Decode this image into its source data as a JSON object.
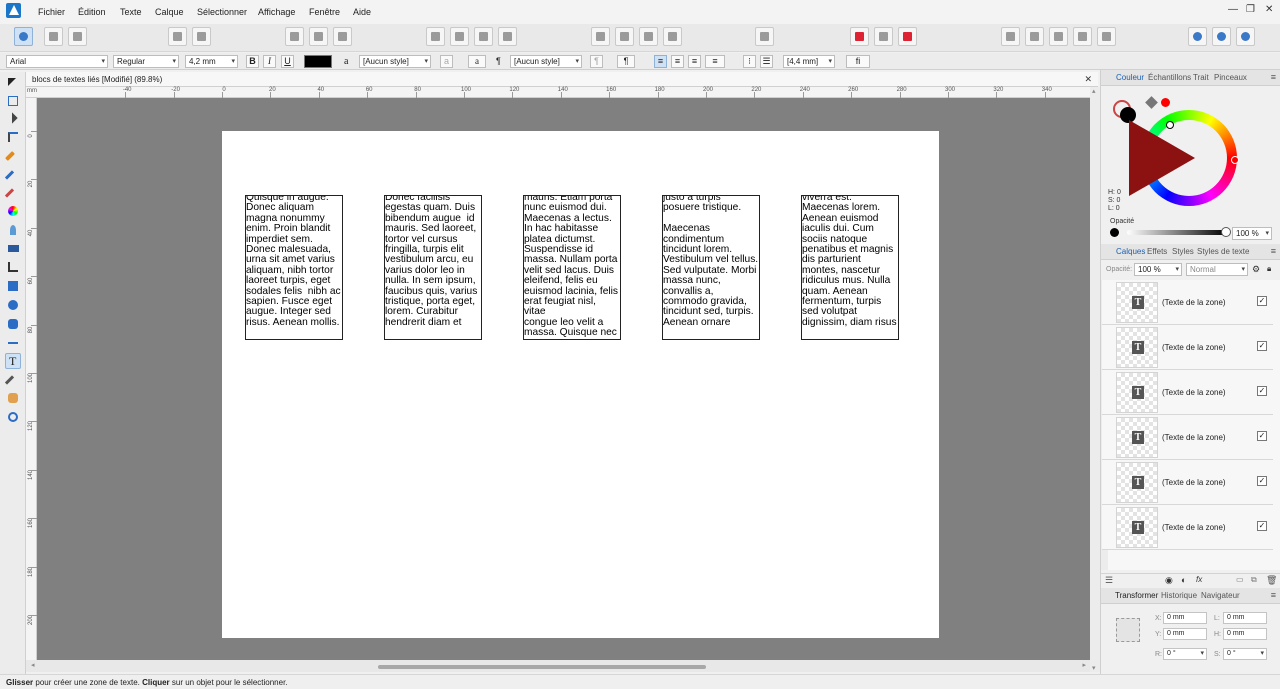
{
  "menu": [
    "Fichier",
    "Édition",
    "Texte",
    "Calque",
    "Sélectionner",
    "Affichage",
    "Fenêtre",
    "Aide"
  ],
  "window_controls": [
    "—",
    "❐",
    "✕"
  ],
  "context_bar": {
    "font_family": "Arial",
    "font_style": "Regular",
    "font_size": "4,2 mm",
    "bold": "B",
    "italic": "I",
    "underline": "U",
    "text_color": "#000000",
    "char_style_glyph": "a",
    "char_style": "[Aucun style]",
    "char_a_glyph": "a",
    "para_glyph": "¶",
    "para_style": "[Aucun style]",
    "para_btn": "¶",
    "line_spacing": "[4,4 mm]",
    "ligature": "fi"
  },
  "document": {
    "tab_title": "blocs de textes liés [Modifié] (89.8%)",
    "close": "✕"
  },
  "ruler": {
    "unit": "mm",
    "top_labels": [
      "-40",
      "-20",
      "0",
      "20",
      "40",
      "60",
      "80",
      "100",
      "120",
      "140",
      "160",
      "180",
      "200",
      "220",
      "240",
      "260",
      "280",
      "300",
      "320",
      "340"
    ],
    "left_labels": [
      "0",
      "20",
      "40",
      "60",
      "80",
      "100",
      "120",
      "140",
      "160",
      "180",
      "200"
    ]
  },
  "frames": [
    "Quisque in augue.\nDonec aliquam\nmagna nonummy\nenim. Proin blandit\nimperdiet sem.\nDonec malesuada,\nurna sit amet varius\naliquam, nibh tortor\nlaoreet turpis, eget\nsodales felis  nibh ac\nsapien. Fusce eget\naugue. Integer sed\nrisus. Aenean mollis.",
    "Donec facilisis\negestas quam. Duis\nbibendum augue  id\nmauris. Sed laoreet,\ntortor vel cursus\nfringilla, turpis elit\nvestibulum arcu, eu\nvarius dolor leo in\nnulla. In sem ipsum,\nfaucibus quis, varius\ntristique, porta eget,\nlorem. Curabitur\nhendrerit diam et",
    "mauris. Etiam porta\nnunc euismod dui.\nMaecenas a lectus.\nIn hac habitasse\nplatea dictumst.\nSuspendisse id\nmassa. Nullam porta\nvelit sed lacus. Duis\neleifend, felis eu\neuismod lacinia, felis\nerat feugiat nisl, vitae\ncongue leo velit a\nmassa. Quisque nec",
    "justo a turpis\nposuere tristique.\n\nMaecenas\ncondimentum\ntincidunt lorem.\nVestibulum vel tellus.\nSed vulputate. Morbi\nmassa nunc,\nconvallis a,\ncommodo gravida,\ntincidunt sed, turpis.\nAenean ornare",
    "viverra est.\nMaecenas lorem.\nAenean euismod\niaculis dui. Cum\nsociis natoque\npenatibus et magnis\ndis parturient\nmontes, nascetur\nridiculus mus. Nulla\nquam. Aenean\nfermentum, turpis\nsed volutpat\ndignissim, diam risus"
  ],
  "color_panel": {
    "tabs": [
      "Couleur",
      "Échantillons",
      "Trait",
      "Pinceaux"
    ],
    "h": "H: 0",
    "s": "S: 0",
    "l": "L: 0",
    "opacity_label": "Opacité",
    "opacity_value": "100 %",
    "fill_color": "#000000",
    "accent_color": "#ff0000"
  },
  "layers_panel": {
    "tabs": [
      "Calques",
      "Effets",
      "Styles",
      "Styles de texte"
    ],
    "opacity_label": "Opacité:",
    "opacity_value": "100 %",
    "blend_mode": "Normal",
    "layers": [
      {
        "name": "(Texte de la zone)",
        "icon": "T"
      },
      {
        "name": "(Texte de la zone)",
        "icon": "T"
      },
      {
        "name": "(Texte de la zone)",
        "icon": "T"
      },
      {
        "name": "(Texte de la zone)",
        "icon": "T"
      },
      {
        "name": "(Texte de la zone)",
        "icon": "T"
      },
      {
        "name": "(Texte de la zone)",
        "icon": "T"
      }
    ],
    "check": "✓",
    "fx": "fx"
  },
  "transform_panel": {
    "tabs": [
      "Transformer",
      "Historique",
      "Navigateur"
    ],
    "x_label": "X:",
    "x_value": "0 mm",
    "y_label": "Y:",
    "y_value": "0 mm",
    "w_label": "L:",
    "w_value": "0 mm",
    "h_label": "H:",
    "h_value": "0 mm",
    "r_label": "R:",
    "r_value": "0 °",
    "s_label": "S:",
    "s_value": "0 °"
  },
  "status": {
    "bold1": "Glisser",
    "text1": " pour créer une zone de texte. ",
    "bold2": "Cliquer",
    "text2": " sur un objet pour le sélectionner."
  }
}
